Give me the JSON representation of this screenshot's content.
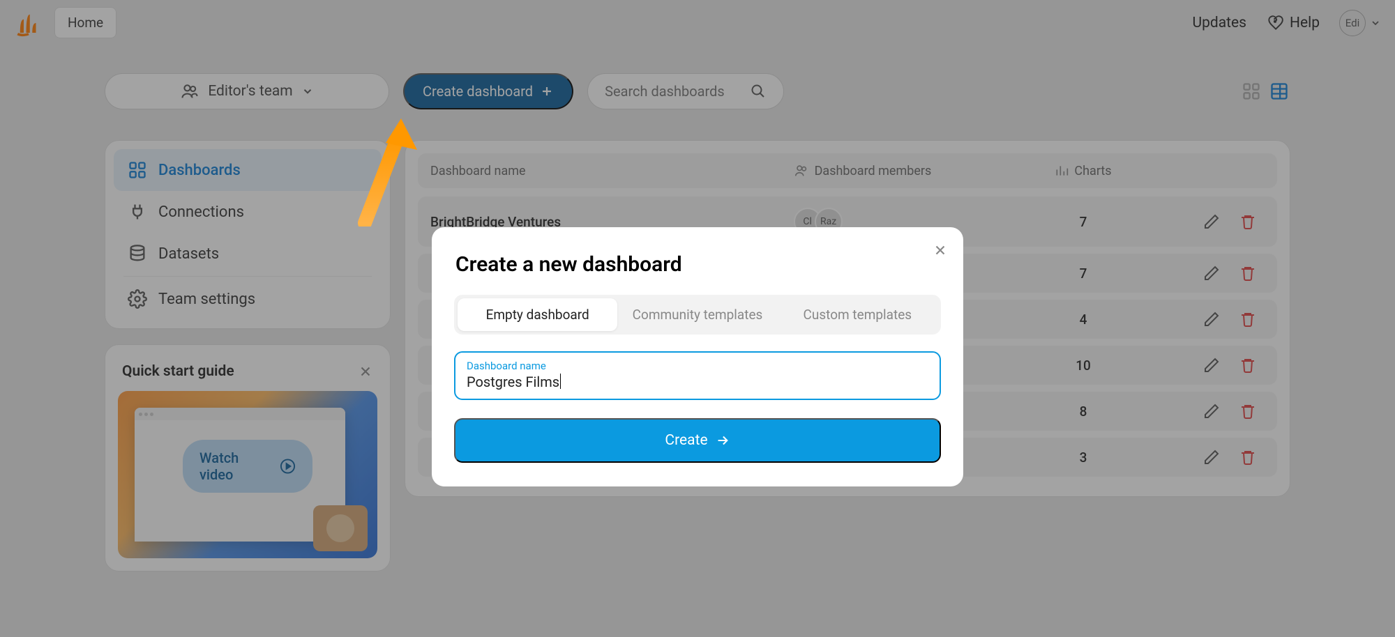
{
  "topbar": {
    "home": "Home",
    "updates": "Updates",
    "help": "Help",
    "avatar": "Edi"
  },
  "controls": {
    "team": "Editor's team",
    "create": "Create dashboard",
    "search_placeholder": "Search dashboards"
  },
  "nav": {
    "dashboards": "Dashboards",
    "connections": "Connections",
    "datasets": "Datasets",
    "team_settings": "Team settings"
  },
  "quickstart": {
    "title": "Quick start guide",
    "watch": "Watch video"
  },
  "table": {
    "col_name": "Dashboard name",
    "col_members": "Dashboard members",
    "col_charts": "Charts",
    "rows": [
      {
        "name": "BrightBridge Ventures",
        "m1": "Cl",
        "m2": "Raz",
        "charts": "7"
      },
      {
        "name": "",
        "m1": "",
        "m2": "",
        "charts": "7"
      },
      {
        "name": "",
        "m1": "",
        "m2": "",
        "charts": "4"
      },
      {
        "name": "",
        "m1": "",
        "m2": "",
        "charts": "10"
      },
      {
        "name": "",
        "m1": "",
        "m2": "",
        "charts": "8"
      },
      {
        "name": "",
        "m1": "",
        "m2": "",
        "charts": "3"
      }
    ]
  },
  "modal": {
    "title": "Create a new dashboard",
    "tab_empty": "Empty dashboard",
    "tab_community": "Community templates",
    "tab_custom": "Custom templates",
    "input_label": "Dashboard name",
    "input_value": "Postgres Films",
    "submit": "Create"
  }
}
